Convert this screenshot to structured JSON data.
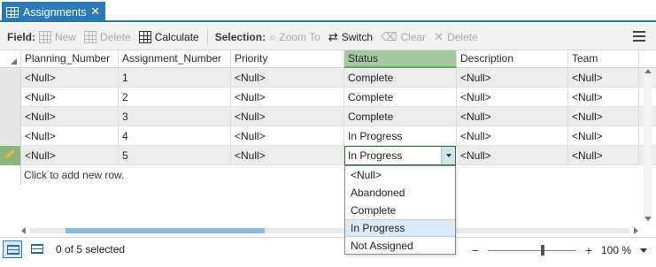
{
  "tab": {
    "title": "Assignments",
    "close": "✕"
  },
  "toolbar": {
    "field_label": "Field:",
    "new_label": "New",
    "delete_field_label": "Delete",
    "calculate_label": "Calculate",
    "selection_label": "Selection:",
    "zoom_to_label": "Zoom To",
    "switch_label": "Switch",
    "clear_label": "Clear",
    "delete_sel_label": "Delete",
    "delete_glyph": "✕"
  },
  "table": {
    "columns": [
      "Planning_Number",
      "Assignment_Number",
      "Priority",
      "Status",
      "Description",
      "Team"
    ],
    "rows": [
      [
        "<Null>",
        "1",
        "<Null>",
        "Complete",
        "<Null>",
        "<Null>"
      ],
      [
        "<Null>",
        "2",
        "<Null>",
        "Complete",
        "<Null>",
        "<Null>"
      ],
      [
        "<Null>",
        "3",
        "<Null>",
        "Complete",
        "<Null>",
        "<Null>"
      ],
      [
        "<Null>",
        "4",
        "<Null>",
        "In Progress",
        "<Null>",
        "<Null>"
      ],
      [
        "<Null>",
        "5",
        "<Null>",
        "In Progress",
        "<Null>",
        "<Null>"
      ]
    ],
    "add_row_text": "Click to add new row."
  },
  "status_dropdown": {
    "options": [
      "<Null>",
      "Abandoned",
      "Complete",
      "In Progress",
      "Not Assigned"
    ],
    "selected": "In Progress"
  },
  "statusbar": {
    "selection_count": "0 of 5 selected",
    "zoom_minus": "−",
    "zoom_plus": "+",
    "zoom_value": "100 %"
  },
  "colors": {
    "tab_blue": "#2a7ab8",
    "selected_column_green": "#a4c8a0",
    "dropdown_highlight": "#dbeaf7"
  }
}
